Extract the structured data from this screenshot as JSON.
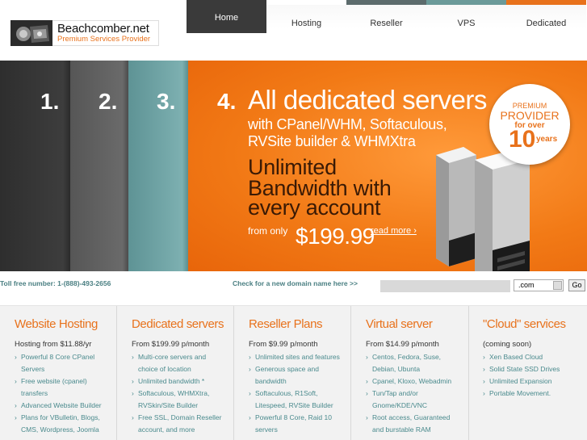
{
  "logo": {
    "name": "Beachcomber.net",
    "tagline": "Premium Services Provider"
  },
  "nav": {
    "items": [
      {
        "label": "Home",
        "active": true
      },
      {
        "label": "Hosting",
        "active": false
      },
      {
        "label": "Reseller",
        "active": false
      },
      {
        "label": "VPS",
        "active": false
      },
      {
        "label": "Dedicated",
        "active": false
      }
    ]
  },
  "banner": {
    "steps": [
      "1.",
      "2.",
      "3.",
      "4."
    ],
    "headline": "All dedicated servers",
    "sub1": "with CPanel/WHM, Softaculous,",
    "sub2": "RVSite builder & WHMXtra",
    "big1": "Unlimited",
    "big2": "Bandwidth with",
    "big3": "every account",
    "from_only": "from only",
    "price": "$199.99",
    "read_more": "read more ›",
    "badge": {
      "line1": "PREMIUM",
      "line2": "PROVIDER",
      "line3": "for over",
      "line4": "10",
      "line5": "years"
    },
    "colors": {
      "orange": "#f27a16",
      "dark": "#2e2e2e",
      "gray": "#5c5c5c",
      "teal": "#6b9a99"
    }
  },
  "strip": {
    "toll_free": "Toll free number: 1-(888)-493-2656",
    "domain_prompt": "Check for a new domain name here  >>",
    "domain_value": "",
    "tld_selected": ".com",
    "go_label": "Go"
  },
  "plans": [
    {
      "title": "Website Hosting",
      "price": "Hosting from $11.88/yr",
      "items": [
        "Powerful 8 Core CPanel",
        "Servers",
        "Free website (cpanel)",
        "transfers",
        "Advanced Website Builder",
        "Plans for VBulletin, Blogs,",
        "CMS, Wordpress, Joomla"
      ],
      "bullets": [
        true,
        false,
        true,
        false,
        true,
        true,
        false
      ]
    },
    {
      "title": "Dedicated servers",
      "price": "From $199.99 p/month",
      "items": [
        "Multi-core servers and",
        "choice of location",
        "Unlimited bandwidth *",
        "Softaculous, WHMXtra,",
        "RVSkin/Site Builder",
        "Free SSL, Domain Reseller",
        "account, and more"
      ],
      "bullets": [
        true,
        false,
        true,
        true,
        false,
        true,
        false
      ]
    },
    {
      "title": "Reseller Plans",
      "price": "From $9.99 p/month",
      "items": [
        "Unlimited sites and features",
        "Generous space and",
        "bandwidth",
        "Softaculous, R1Soft,",
        "Litespeed, RVSite Builder",
        "Powerful 8 Core, Raid 10",
        "servers"
      ],
      "bullets": [
        true,
        true,
        false,
        true,
        false,
        true,
        false
      ]
    },
    {
      "title": "Virtual server",
      "price": "From $14.99 p/month",
      "items": [
        "Centos, Fedora, Suse,",
        "Debian, Ubunta",
        "Cpanel, Kloxo, Webadmin",
        "Tun/Tap and/or",
        "Gnome/KDE/VNC",
        "Root access, Guaranteed",
        "and burstable RAM"
      ],
      "bullets": [
        true,
        false,
        true,
        true,
        false,
        true,
        false
      ]
    },
    {
      "title": "\"Cloud\" services",
      "price": "(coming soon)",
      "items": [
        "Xen Based Cloud",
        "Solid State SSD Drives",
        "Unlimited Expansion",
        "Portable Movement."
      ],
      "bullets": [
        true,
        true,
        true,
        true
      ]
    }
  ]
}
